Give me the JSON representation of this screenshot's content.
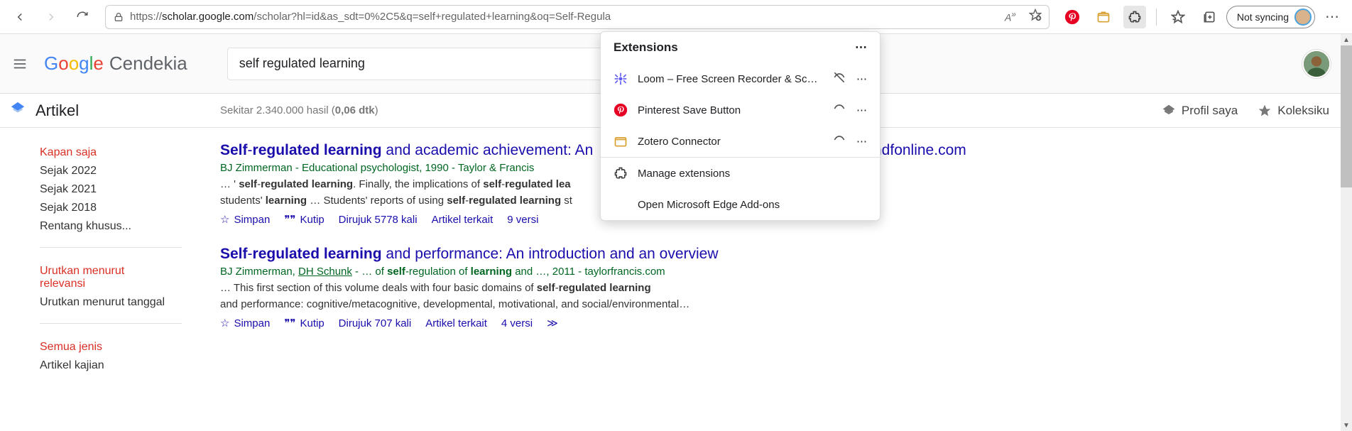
{
  "browser": {
    "url_prefix": "https://",
    "url_host": "scholar.google.com",
    "url_path": "/scholar?hl=id&as_sdt=0%2C5&q=self+regulated+learning&oq=Self-Regula",
    "not_syncing": "Not syncing"
  },
  "extensions": {
    "title": "Extensions",
    "items": [
      {
        "name": "Loom – Free Screen Recorder & Sc…",
        "icon": "loom"
      },
      {
        "name": "Pinterest Save Button",
        "icon": "pinterest"
      },
      {
        "name": "Zotero Connector",
        "icon": "zotero"
      }
    ],
    "manage": "Manage extensions",
    "addons": "Open Microsoft Edge Add-ons"
  },
  "scholar": {
    "logo_g": "G",
    "logo_o1": "o",
    "logo_o2": "o",
    "logo_g2": "g",
    "logo_l": "l",
    "logo_e": "e",
    "logo_name": "Cendekia",
    "search_value": "self regulated learning",
    "artikel": "Artikel",
    "result_count": "Sekitar 2.340.000 hasil (0,06 dtk)",
    "profil": "Profil saya",
    "koleksi": "Koleksiku"
  },
  "sidebar": {
    "group1": [
      "Kapan saja",
      "Sejak 2022",
      "Sejak 2021",
      "Sejak 2018",
      "Rentang khusus..."
    ],
    "group2": [
      "Urutkan menurut relevansi",
      "Urutkan menurut tanggal"
    ],
    "group3": [
      "Semua jenis",
      "Artikel kajian"
    ]
  },
  "results": [
    {
      "title_html": "<b>Self</b>-<b>regulated learning</b> and academic achievement: An",
      "meta_html": "BJ Zimmerman - Educational psychologist, 1990 - Taylor & Francis",
      "snippet_html": "… ' <b>self</b>-<b>regulated learning</b>. Finally, the implications of <b>self</b>-<b>regulated lea</b><br>students' <b>learning</b> … Students' reports of using <b>self</b>-<b>regulated learning</b> st",
      "save": "Simpan",
      "cite": "Kutip",
      "cited": "Dirujuk 5778 kali",
      "related": "Artikel terkait",
      "versions": "9 versi",
      "src": "ndfonline.com"
    },
    {
      "title_html": "<b>Self</b>-<b>regulated learning</b> and performance: An introduction and an overview",
      "meta_html": "BJ Zimmerman, <a>DH Schunk</a> - … of <b>self</b>-regulation of <b>learning</b> and …, 2011 - taylorfrancis.com",
      "snippet_html": "… This first section of this volume deals with four basic domains of <b>self</b>-<b>regulated learning</b><br>and performance: cognitive/metacognitive, developmental, motivational, and social/environmental…",
      "save": "Simpan",
      "cite": "Kutip",
      "cited": "Dirujuk 707 kali",
      "related": "Artikel terkait",
      "versions": "4 versi",
      "src": ""
    }
  ]
}
